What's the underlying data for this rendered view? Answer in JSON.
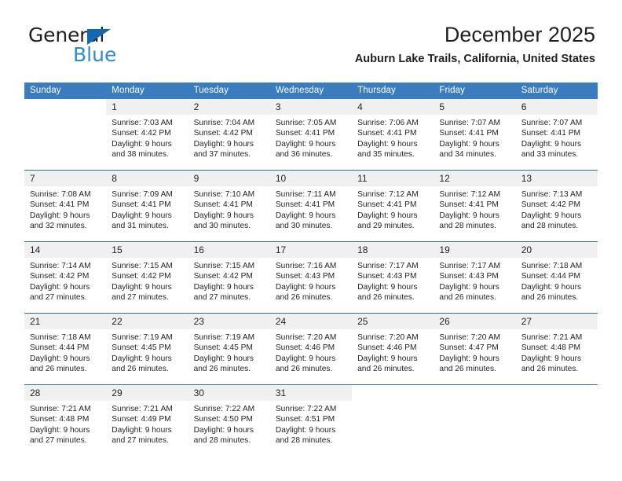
{
  "brand": {
    "name_part1": "General",
    "name_part2": "Blue",
    "triangle_color": "#1268b3",
    "blue_color": "#2e8bd0"
  },
  "header": {
    "title": "December 2025",
    "location": "Auburn Lake Trails, California, United States"
  },
  "theme": {
    "header_bar_color": "#3a7cc0",
    "row_separator_color": "#2e6da4",
    "daynum_background": "#f0f0f0",
    "text_color": "#231f20"
  },
  "weekday_headers": [
    "Sunday",
    "Monday",
    "Tuesday",
    "Wednesday",
    "Thursday",
    "Friday",
    "Saturday"
  ],
  "labels": {
    "sunrise_prefix": "Sunrise:",
    "sunset_prefix": "Sunset:",
    "daylight_prefix": "Daylight:"
  },
  "weeks": [
    [
      {
        "empty": true
      },
      {
        "day": "1",
        "sunrise": "Sunrise: 7:03 AM",
        "sunset": "Sunset: 4:42 PM",
        "daylight_line1": "Daylight: 9 hours",
        "daylight_line2": "and 38 minutes."
      },
      {
        "day": "2",
        "sunrise": "Sunrise: 7:04 AM",
        "sunset": "Sunset: 4:42 PM",
        "daylight_line1": "Daylight: 9 hours",
        "daylight_line2": "and 37 minutes."
      },
      {
        "day": "3",
        "sunrise": "Sunrise: 7:05 AM",
        "sunset": "Sunset: 4:41 PM",
        "daylight_line1": "Daylight: 9 hours",
        "daylight_line2": "and 36 minutes."
      },
      {
        "day": "4",
        "sunrise": "Sunrise: 7:06 AM",
        "sunset": "Sunset: 4:41 PM",
        "daylight_line1": "Daylight: 9 hours",
        "daylight_line2": "and 35 minutes."
      },
      {
        "day": "5",
        "sunrise": "Sunrise: 7:07 AM",
        "sunset": "Sunset: 4:41 PM",
        "daylight_line1": "Daylight: 9 hours",
        "daylight_line2": "and 34 minutes."
      },
      {
        "day": "6",
        "sunrise": "Sunrise: 7:07 AM",
        "sunset": "Sunset: 4:41 PM",
        "daylight_line1": "Daylight: 9 hours",
        "daylight_line2": "and 33 minutes."
      }
    ],
    [
      {
        "day": "7",
        "sunrise": "Sunrise: 7:08 AM",
        "sunset": "Sunset: 4:41 PM",
        "daylight_line1": "Daylight: 9 hours",
        "daylight_line2": "and 32 minutes."
      },
      {
        "day": "8",
        "sunrise": "Sunrise: 7:09 AM",
        "sunset": "Sunset: 4:41 PM",
        "daylight_line1": "Daylight: 9 hours",
        "daylight_line2": "and 31 minutes."
      },
      {
        "day": "9",
        "sunrise": "Sunrise: 7:10 AM",
        "sunset": "Sunset: 4:41 PM",
        "daylight_line1": "Daylight: 9 hours",
        "daylight_line2": "and 30 minutes."
      },
      {
        "day": "10",
        "sunrise": "Sunrise: 7:11 AM",
        "sunset": "Sunset: 4:41 PM",
        "daylight_line1": "Daylight: 9 hours",
        "daylight_line2": "and 30 minutes."
      },
      {
        "day": "11",
        "sunrise": "Sunrise: 7:12 AM",
        "sunset": "Sunset: 4:41 PM",
        "daylight_line1": "Daylight: 9 hours",
        "daylight_line2": "and 29 minutes."
      },
      {
        "day": "12",
        "sunrise": "Sunrise: 7:12 AM",
        "sunset": "Sunset: 4:41 PM",
        "daylight_line1": "Daylight: 9 hours",
        "daylight_line2": "and 28 minutes."
      },
      {
        "day": "13",
        "sunrise": "Sunrise: 7:13 AM",
        "sunset": "Sunset: 4:42 PM",
        "daylight_line1": "Daylight: 9 hours",
        "daylight_line2": "and 28 minutes."
      }
    ],
    [
      {
        "day": "14",
        "sunrise": "Sunrise: 7:14 AM",
        "sunset": "Sunset: 4:42 PM",
        "daylight_line1": "Daylight: 9 hours",
        "daylight_line2": "and 27 minutes."
      },
      {
        "day": "15",
        "sunrise": "Sunrise: 7:15 AM",
        "sunset": "Sunset: 4:42 PM",
        "daylight_line1": "Daylight: 9 hours",
        "daylight_line2": "and 27 minutes."
      },
      {
        "day": "16",
        "sunrise": "Sunrise: 7:15 AM",
        "sunset": "Sunset: 4:42 PM",
        "daylight_line1": "Daylight: 9 hours",
        "daylight_line2": "and 27 minutes."
      },
      {
        "day": "17",
        "sunrise": "Sunrise: 7:16 AM",
        "sunset": "Sunset: 4:43 PM",
        "daylight_line1": "Daylight: 9 hours",
        "daylight_line2": "and 26 minutes."
      },
      {
        "day": "18",
        "sunrise": "Sunrise: 7:17 AM",
        "sunset": "Sunset: 4:43 PM",
        "daylight_line1": "Daylight: 9 hours",
        "daylight_line2": "and 26 minutes."
      },
      {
        "day": "19",
        "sunrise": "Sunrise: 7:17 AM",
        "sunset": "Sunset: 4:43 PM",
        "daylight_line1": "Daylight: 9 hours",
        "daylight_line2": "and 26 minutes."
      },
      {
        "day": "20",
        "sunrise": "Sunrise: 7:18 AM",
        "sunset": "Sunset: 4:44 PM",
        "daylight_line1": "Daylight: 9 hours",
        "daylight_line2": "and 26 minutes."
      }
    ],
    [
      {
        "day": "21",
        "sunrise": "Sunrise: 7:18 AM",
        "sunset": "Sunset: 4:44 PM",
        "daylight_line1": "Daylight: 9 hours",
        "daylight_line2": "and 26 minutes."
      },
      {
        "day": "22",
        "sunrise": "Sunrise: 7:19 AM",
        "sunset": "Sunset: 4:45 PM",
        "daylight_line1": "Daylight: 9 hours",
        "daylight_line2": "and 26 minutes."
      },
      {
        "day": "23",
        "sunrise": "Sunrise: 7:19 AM",
        "sunset": "Sunset: 4:45 PM",
        "daylight_line1": "Daylight: 9 hours",
        "daylight_line2": "and 26 minutes."
      },
      {
        "day": "24",
        "sunrise": "Sunrise: 7:20 AM",
        "sunset": "Sunset: 4:46 PM",
        "daylight_line1": "Daylight: 9 hours",
        "daylight_line2": "and 26 minutes."
      },
      {
        "day": "25",
        "sunrise": "Sunrise: 7:20 AM",
        "sunset": "Sunset: 4:46 PM",
        "daylight_line1": "Daylight: 9 hours",
        "daylight_line2": "and 26 minutes."
      },
      {
        "day": "26",
        "sunrise": "Sunrise: 7:20 AM",
        "sunset": "Sunset: 4:47 PM",
        "daylight_line1": "Daylight: 9 hours",
        "daylight_line2": "and 26 minutes."
      },
      {
        "day": "27",
        "sunrise": "Sunrise: 7:21 AM",
        "sunset": "Sunset: 4:48 PM",
        "daylight_line1": "Daylight: 9 hours",
        "daylight_line2": "and 26 minutes."
      }
    ],
    [
      {
        "day": "28",
        "sunrise": "Sunrise: 7:21 AM",
        "sunset": "Sunset: 4:48 PM",
        "daylight_line1": "Daylight: 9 hours",
        "daylight_line2": "and 27 minutes."
      },
      {
        "day": "29",
        "sunrise": "Sunrise: 7:21 AM",
        "sunset": "Sunset: 4:49 PM",
        "daylight_line1": "Daylight: 9 hours",
        "daylight_line2": "and 27 minutes."
      },
      {
        "day": "30",
        "sunrise": "Sunrise: 7:22 AM",
        "sunset": "Sunset: 4:50 PM",
        "daylight_line1": "Daylight: 9 hours",
        "daylight_line2": "and 28 minutes."
      },
      {
        "day": "31",
        "sunrise": "Sunrise: 7:22 AM",
        "sunset": "Sunset: 4:51 PM",
        "daylight_line1": "Daylight: 9 hours",
        "daylight_line2": "and 28 minutes."
      },
      {
        "empty": true
      },
      {
        "empty": true
      },
      {
        "empty": true
      }
    ]
  ]
}
